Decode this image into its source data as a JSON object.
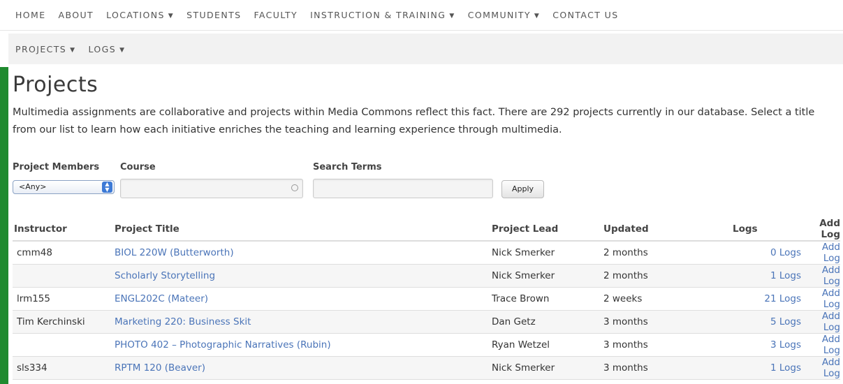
{
  "nav": {
    "row1": [
      {
        "label": "HOME",
        "dropdown": false
      },
      {
        "label": "ABOUT",
        "dropdown": false
      },
      {
        "label": "LOCATIONS",
        "dropdown": true
      },
      {
        "label": "STUDENTS",
        "dropdown": false
      },
      {
        "label": "FACULTY",
        "dropdown": false
      },
      {
        "label": "INSTRUCTION & TRAINING",
        "dropdown": true
      },
      {
        "label": "COMMUNITY",
        "dropdown": true
      },
      {
        "label": "CONTACT US",
        "dropdown": false
      }
    ],
    "row2": [
      {
        "label": "PROJECTS",
        "dropdown": true
      },
      {
        "label": "LOGS",
        "dropdown": true
      }
    ],
    "caret": "▼"
  },
  "page": {
    "title": "Projects",
    "intro": "Multimedia assignments are collaborative and projects within Media Commons reflect this fact. There are 292 projects currently in our database. Select a title from our list to learn how each initiative enriches the teaching and learning experience through multimedia."
  },
  "filters": {
    "members_label": "Project Members",
    "members_value": "<Any>",
    "course_label": "Course",
    "course_value": "",
    "search_label": "Search Terms",
    "search_value": "",
    "apply_label": "Apply"
  },
  "table": {
    "headers": {
      "instructor": "Instructor",
      "title": "Project Title",
      "lead": "Project Lead",
      "updated": "Updated",
      "logs": "Logs",
      "addlog": "Add Log"
    },
    "rows": [
      {
        "instructor": "cmm48",
        "title": "BIOL 220W (Butterworth)",
        "lead": "Nick Smerker",
        "updated": "2 months",
        "logs": "0 Logs",
        "addlog": "Add Log"
      },
      {
        "instructor": "",
        "title": "Scholarly Storytelling",
        "lead": "Nick Smerker",
        "updated": "2 months",
        "logs": "1 Logs",
        "addlog": "Add Log"
      },
      {
        "instructor": "lrm155",
        "title": "ENGL202C (Mateer)",
        "lead": "Trace Brown",
        "updated": "2 weeks",
        "logs": "21 Logs",
        "addlog": "Add Log"
      },
      {
        "instructor": "Tim Kerchinski",
        "title": "Marketing 220: Business Skit",
        "lead": "Dan Getz",
        "updated": "3 months",
        "logs": "5 Logs",
        "addlog": "Add Log"
      },
      {
        "instructor": "",
        "title": "PHOTO 402 – Photographic Narratives (Rubin)",
        "lead": "Ryan Wetzel",
        "updated": "3 months",
        "logs": "3 Logs",
        "addlog": "Add Log"
      },
      {
        "instructor": "sls334",
        "title": "RPTM 120 (Beaver)",
        "lead": "Nick Smerker",
        "updated": "3 months",
        "logs": "1 Logs",
        "addlog": "Add Log"
      }
    ]
  }
}
